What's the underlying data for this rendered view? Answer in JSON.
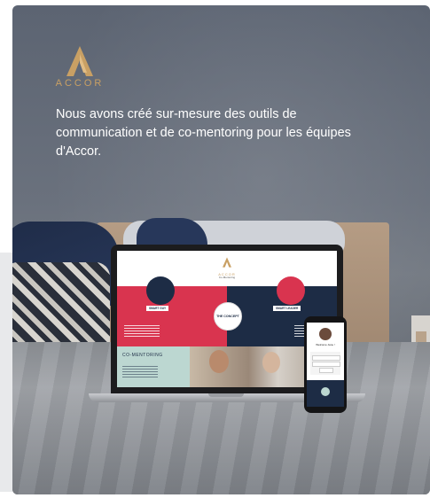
{
  "brand": {
    "name": "ACCOR",
    "accent": "#c9a064"
  },
  "headline": "Nous avons créé sur-mesure des outils de communication et de co-mentoring pour les équipes d'Accor.",
  "mockup": {
    "site_logo_text": "ACCOR",
    "subtitle": "Co-Mentoring",
    "left_tag": "SMART GUY",
    "right_tag": "SMART LEADER",
    "center_label": "THE CONCEPT",
    "section_title": "CO-MENTORING",
    "phone_name": "Welcome Jane !"
  },
  "colors": {
    "red": "#d9344f",
    "navy": "#1d2c45",
    "teal": "#bcd7d1"
  }
}
